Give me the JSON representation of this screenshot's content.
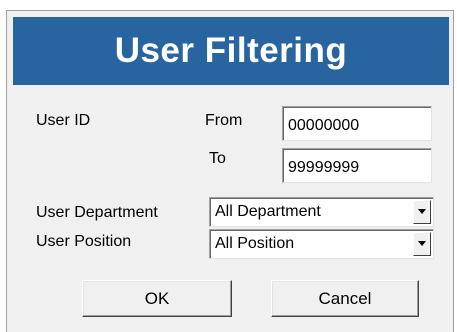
{
  "dialog": {
    "title": "User Filtering",
    "banner_color": "#2865a0"
  },
  "user_id": {
    "label": "User ID",
    "from_label": "From",
    "from_value": "00000000",
    "to_label": "To",
    "to_value": "99999999"
  },
  "department": {
    "label": "User Department",
    "selected": "All Department",
    "dropdown_icon": "triangle-down-icon"
  },
  "position": {
    "label": "User Position",
    "selected": "All Position",
    "dropdown_icon": "triangle-down-icon"
  },
  "buttons": {
    "ok_label": "OK",
    "cancel_label": "Cancel"
  }
}
